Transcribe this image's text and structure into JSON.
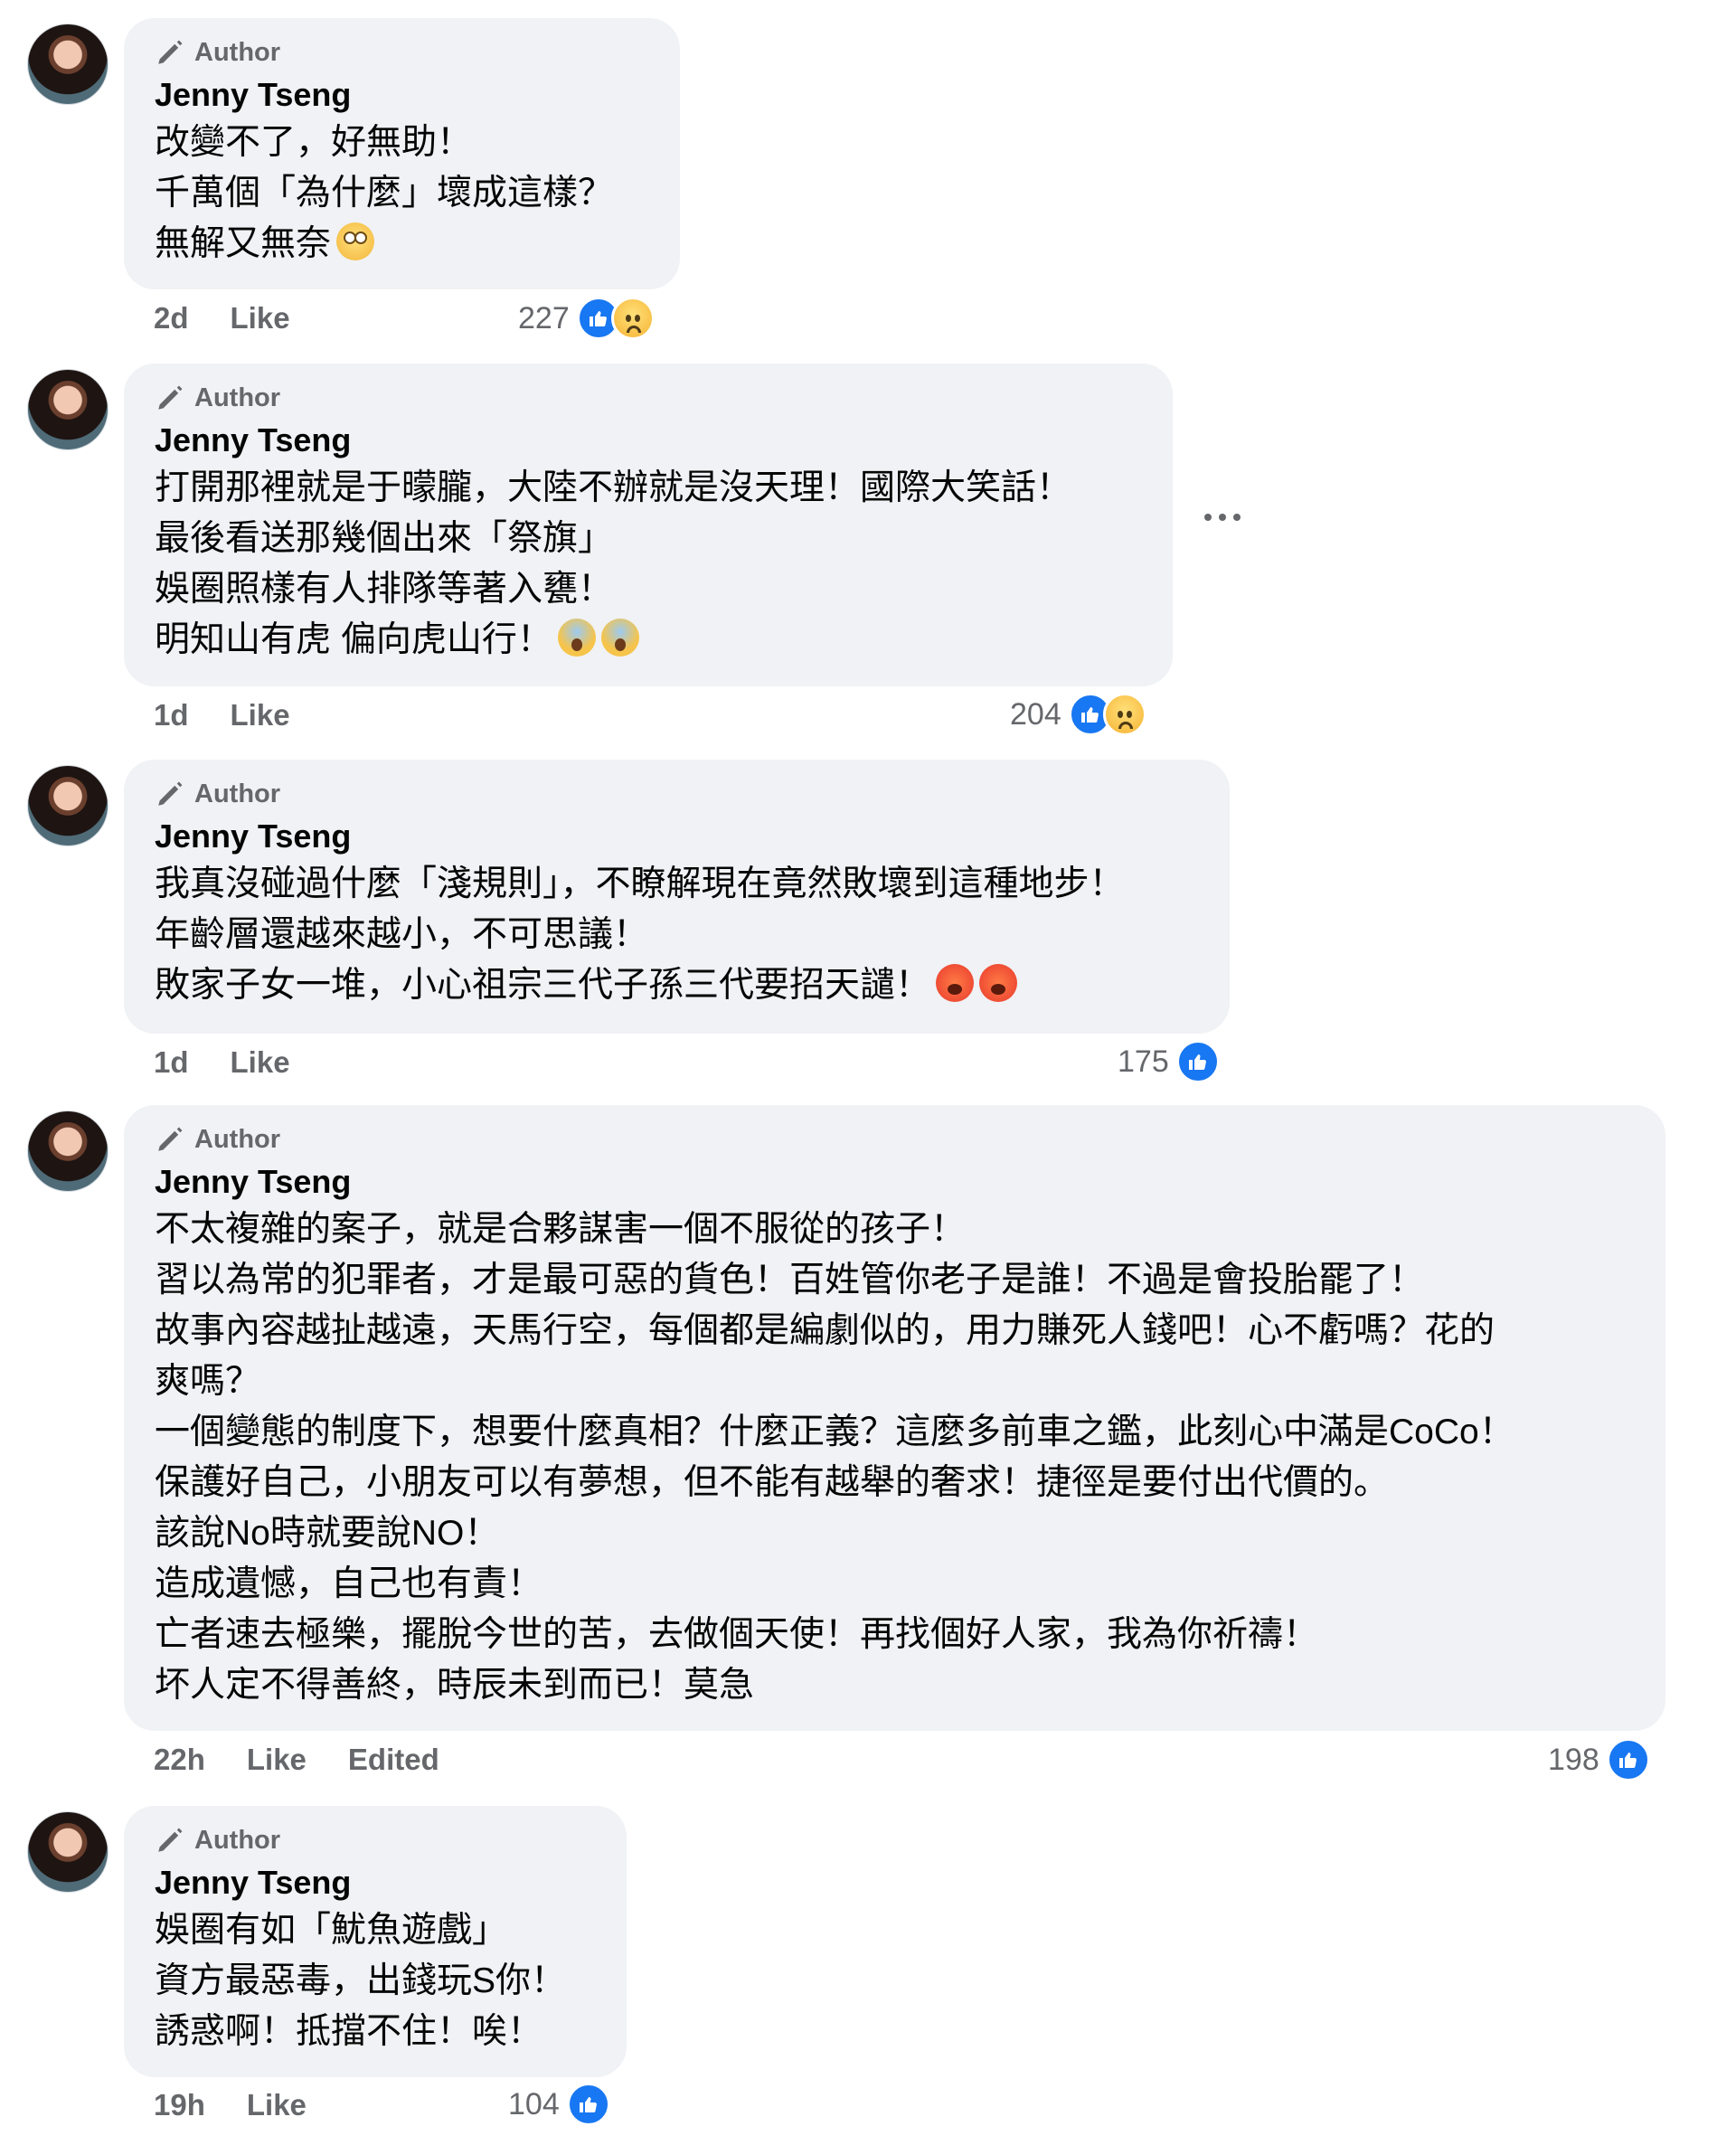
{
  "comments": [
    {
      "badge": "Author",
      "name": "Jenny Tseng",
      "lines": [
        "改變不了，好無助！",
        "千萬個「為什麼」壞成這樣？",
        "無解又無奈"
      ],
      "emoji": [
        "face-with-rolling-eyes"
      ],
      "time": "2d",
      "like_label": "Like",
      "edited": "",
      "reactions_count": "227",
      "reactions": [
        "like",
        "sad"
      ]
    },
    {
      "badge": "Author",
      "name": "Jenny Tseng",
      "lines": [
        "打開那裡就是于曚朧，大陸不辦就是沒天理！國際大笑話！",
        "最後看送那幾個出來「祭旗」",
        "娛圈照樣有人排隊等著入甕！",
        "明知山有虎 偏向虎山行！"
      ],
      "emoji": [
        "face-screaming-in-fear",
        "face-screaming-in-fear"
      ],
      "time": "1d",
      "like_label": "Like",
      "edited": "",
      "reactions_count": "204",
      "reactions": [
        "like",
        "sad"
      ]
    },
    {
      "badge": "Author",
      "name": "Jenny Tseng",
      "lines": [
        "我真沒碰過什麼「淺規則」，不瞭解現在竟然敗壞到這種地步！",
        "年齡層還越來越小，不可思議！",
        "敗家子女一堆，小心祖宗三代子孫三代要招天譴！"
      ],
      "emoji": [
        "hot-face",
        "hot-face"
      ],
      "time": "1d",
      "like_label": "Like",
      "edited": "",
      "reactions_count": "175",
      "reactions": [
        "like"
      ]
    },
    {
      "badge": "Author",
      "name": "Jenny Tseng",
      "lines": [
        "不太複雜的案子，就是合夥謀害一個不服從的孩子！",
        "習以為常的犯罪者，才是最可惡的貨色！百姓管你老子是誰！不過是會投胎罷了！",
        "故事內容越扯越遠，天馬行空，每個都是編劇似的，用力賺死人錢吧！心不虧嗎？花的",
        "爽嗎？",
        "一個變態的制度下，想要什麼真相？什麼正義？這麼多前車之鑑，此刻心中滿是CoCo！",
        "保護好自己，小朋友可以有夢想，但不能有越舉的奢求！捷徑是要付出代價的。",
        "該說No時就要說NO！",
        "造成遺憾，自己也有責！",
        "亡者速去極樂，擺脫今世的苦，去做個天使！再找個好人家，我為你祈禱！",
        "坏人定不得善終，時辰未到而已！莫急"
      ],
      "emoji": [],
      "time": "22h",
      "like_label": "Like",
      "edited": "Edited",
      "reactions_count": "198",
      "reactions": [
        "like"
      ]
    },
    {
      "badge": "Author",
      "name": "Jenny Tseng",
      "lines": [
        "娛圈有如「魷魚遊戲」",
        "資方最惡毒，出錢玩S你！",
        "誘惑啊！抵擋不住！唉！"
      ],
      "emoji": [],
      "time": "19h",
      "like_label": "Like",
      "edited": "",
      "reactions_count": "104",
      "reactions": [
        "like"
      ]
    }
  ]
}
